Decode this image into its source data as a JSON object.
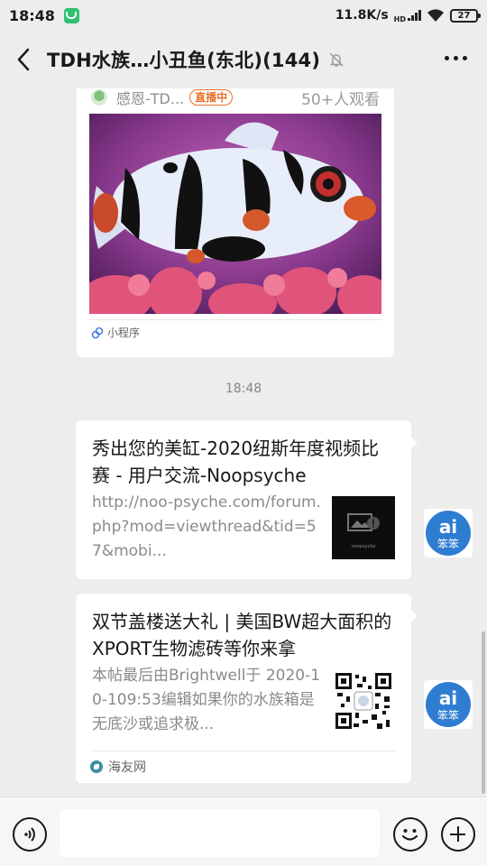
{
  "status_bar": {
    "time": "18:48",
    "network_speed": "11.8K/s",
    "hd_label": "HD",
    "battery": "27"
  },
  "header": {
    "title": "TDH水族…小丑鱼(东北)(144)"
  },
  "messages": {
    "mini_program": {
      "source": "感恩-TD...",
      "live_badge": "直播中",
      "viewers": "50+人观看",
      "footer": "小程序"
    },
    "timestamp": "18:48",
    "link_cards": [
      {
        "title": "秀出您的美缸-2020纽斯年度视频比赛 - 用户交流-Noopsyche",
        "description": "http://noo-psyche.com/forum.php?mod=viewthread&tid=57&mobi...",
        "thumb_caption": "noopsyche",
        "avatar_label": "笨笨"
      },
      {
        "title": "双节盖楼送大礼 | 美国BW超大面积的XPORT生物滤砖等你来拿",
        "description": "本帖最后由Brightwell于 2020-10-109:53编辑如果你的水族箱是无底沙或追求极...",
        "source": "海友网",
        "avatar_label": "笨笨"
      }
    ]
  },
  "input_bar": {
    "placeholder": ""
  },
  "colors": {
    "background": "#ededed",
    "live_orange": "#e8712c",
    "status_green": "#2fbf71"
  }
}
